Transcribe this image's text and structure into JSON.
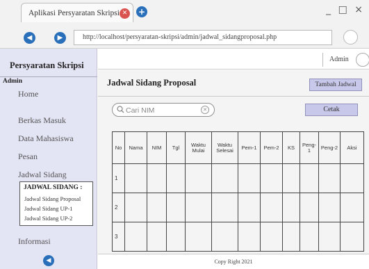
{
  "browser": {
    "tab_title": "Aplikasi Persyaratan Skripsi",
    "url": "http://localhost/persyaratan-skripsi/admin/jadwal_sidangproposal.php",
    "window_controls": "_ □ ×"
  },
  "sidebar": {
    "brand": "Persyaratan Skripsi",
    "role": "Admin",
    "items": [
      {
        "label": "Home"
      },
      {
        "label": "Berkas Masuk"
      },
      {
        "label": "Data Mahasiswa"
      },
      {
        "label": "Pesan"
      },
      {
        "label": "Jadwal Sidang"
      },
      {
        "label": "Informasi"
      }
    ],
    "submenu": {
      "title": "JADWAL SIDANG :",
      "items": [
        {
          "label": "Jadwal Sidang Proposal"
        },
        {
          "label": "Jadwal Sidang UP-1"
        },
        {
          "label": "Jadwal Sidang UP-2"
        }
      ]
    }
  },
  "topbar": {
    "user_label": "Admin"
  },
  "main": {
    "title": "Jadwal Sidang Proposal",
    "add_button": "Tambah Jadwal",
    "search_placeholder": "Cari NIM",
    "print_button": "Cetak",
    "table": {
      "headers": [
        "No",
        "Nama",
        "NIM",
        "Tgl",
        "Waktu Mulai",
        "Waktu Selesai",
        "Pem-1",
        "Pem-2",
        "KS",
        "Peng-1",
        "Peng-2",
        "Aksi"
      ],
      "rows": [
        [
          "1",
          "",
          "",
          "",
          "",
          "",
          "",
          "",
          "",
          "",
          "",
          ""
        ],
        [
          "2",
          "",
          "",
          "",
          "",
          "",
          "",
          "",
          "",
          "",
          "",
          ""
        ],
        [
          "3",
          "",
          "",
          "",
          "",
          "",
          "",
          "",
          "",
          "",
          "",
          ""
        ]
      ]
    }
  },
  "footer": {
    "text": "Copy Right 2021"
  },
  "colors": {
    "sidebar_bg": "#e3e4f4",
    "button_bg": "#c8c8ea",
    "nav_blue": "#2a6fb9",
    "close_red": "#d9534f"
  },
  "icons": {
    "tab_close": "close-icon",
    "new_tab": "plus-icon",
    "back": "back-arrow-icon",
    "forward": "forward-arrow-icon",
    "search": "search-icon",
    "clear": "clear-icon"
  }
}
